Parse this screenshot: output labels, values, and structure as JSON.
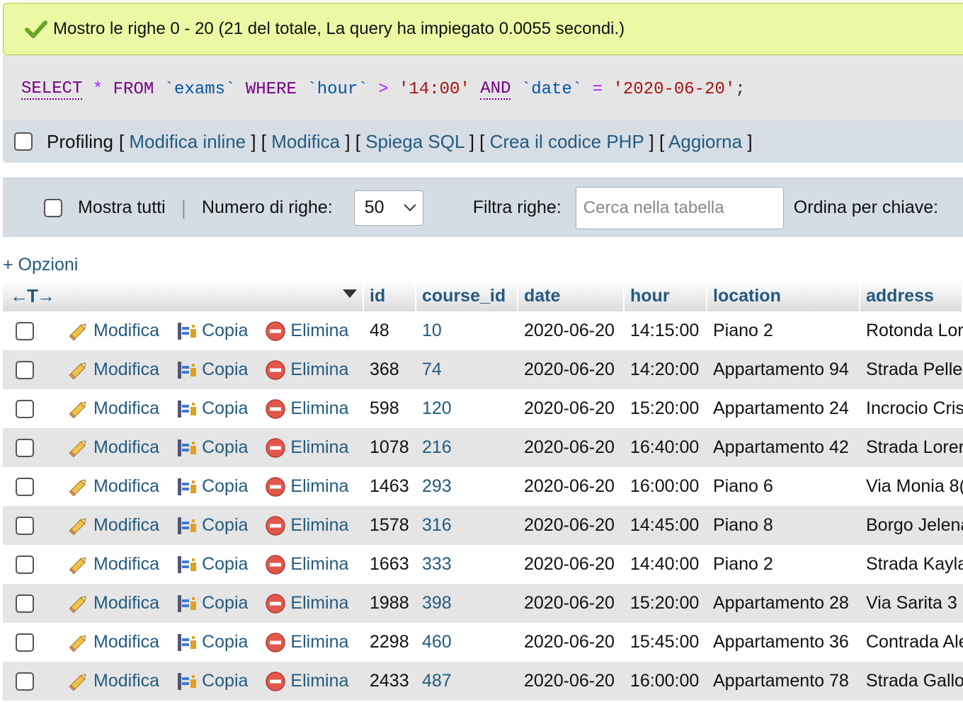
{
  "message": "Mostro le righe 0 - 20 (21 del totale, La query ha impiegato 0.0055 secondi.)",
  "sql": {
    "tokens": [
      {
        "t": "SELECT",
        "c": "kwu"
      },
      {
        "t": " ",
        "c": "pun"
      },
      {
        "t": "*",
        "c": "op"
      },
      {
        "t": " FROM ",
        "c": "kw"
      },
      {
        "t": "`exams`",
        "c": "bt"
      },
      {
        "t": " WHERE ",
        "c": "kw"
      },
      {
        "t": "`hour`",
        "c": "bt"
      },
      {
        "t": " > ",
        "c": "op"
      },
      {
        "t": "'14:00'",
        "c": "str"
      },
      {
        "t": " ",
        "c": "pun"
      },
      {
        "t": "AND",
        "c": "kwu"
      },
      {
        "t": " ",
        "c": "pun"
      },
      {
        "t": "`date`",
        "c": "bt"
      },
      {
        "t": " = ",
        "c": "op"
      },
      {
        "t": "'2020-06-20'",
        "c": "str"
      },
      {
        "t": ";",
        "c": "pun"
      }
    ]
  },
  "sql_actions": {
    "profiling": "Profiling",
    "links": [
      "Modifica inline",
      "Modifica",
      "Spiega SQL",
      "Crea il codice PHP",
      "Aggiorna"
    ]
  },
  "nav": {
    "show_all": "Mostra tutti",
    "rows_label": "Numero di righe:",
    "rows_value": "50",
    "filter_label": "Filtra righe:",
    "filter_placeholder": "Cerca nella tabella",
    "sort_label": "Ordina per chiave:"
  },
  "options_link": "+ Opzioni",
  "table": {
    "columns": [
      "id",
      "course_id",
      "date",
      "hour",
      "location",
      "address"
    ],
    "actions": {
      "edit": "Modifica",
      "copy": "Copia",
      "delete": "Elimina"
    },
    "rows": [
      [
        "48",
        "10",
        "2020-06-20",
        "14:15:00",
        "Piano 2",
        "Rotonda Lor"
      ],
      [
        "368",
        "74",
        "2020-06-20",
        "14:20:00",
        "Appartamento 94",
        "Strada Pelle"
      ],
      [
        "598",
        "120",
        "2020-06-20",
        "15:20:00",
        "Appartamento 24",
        "Incrocio Cris"
      ],
      [
        "1078",
        "216",
        "2020-06-20",
        "16:40:00",
        "Appartamento 42",
        "Strada Lorer"
      ],
      [
        "1463",
        "293",
        "2020-06-20",
        "16:00:00",
        "Piano 6",
        "Via Monia 8("
      ],
      [
        "1578",
        "316",
        "2020-06-20",
        "14:45:00",
        "Piano 8",
        "Borgo Jelena"
      ],
      [
        "1663",
        "333",
        "2020-06-20",
        "14:40:00",
        "Piano 2",
        "Strada Kayla"
      ],
      [
        "1988",
        "398",
        "2020-06-20",
        "15:20:00",
        "Appartamento 28",
        "Via Sarita 3"
      ],
      [
        "2298",
        "460",
        "2020-06-20",
        "15:45:00",
        "Appartamento 36",
        "Contrada Ale"
      ],
      [
        "2433",
        "487",
        "2020-06-20",
        "16:00:00",
        "Appartamento 78",
        "Strada Gallo"
      ]
    ]
  }
}
